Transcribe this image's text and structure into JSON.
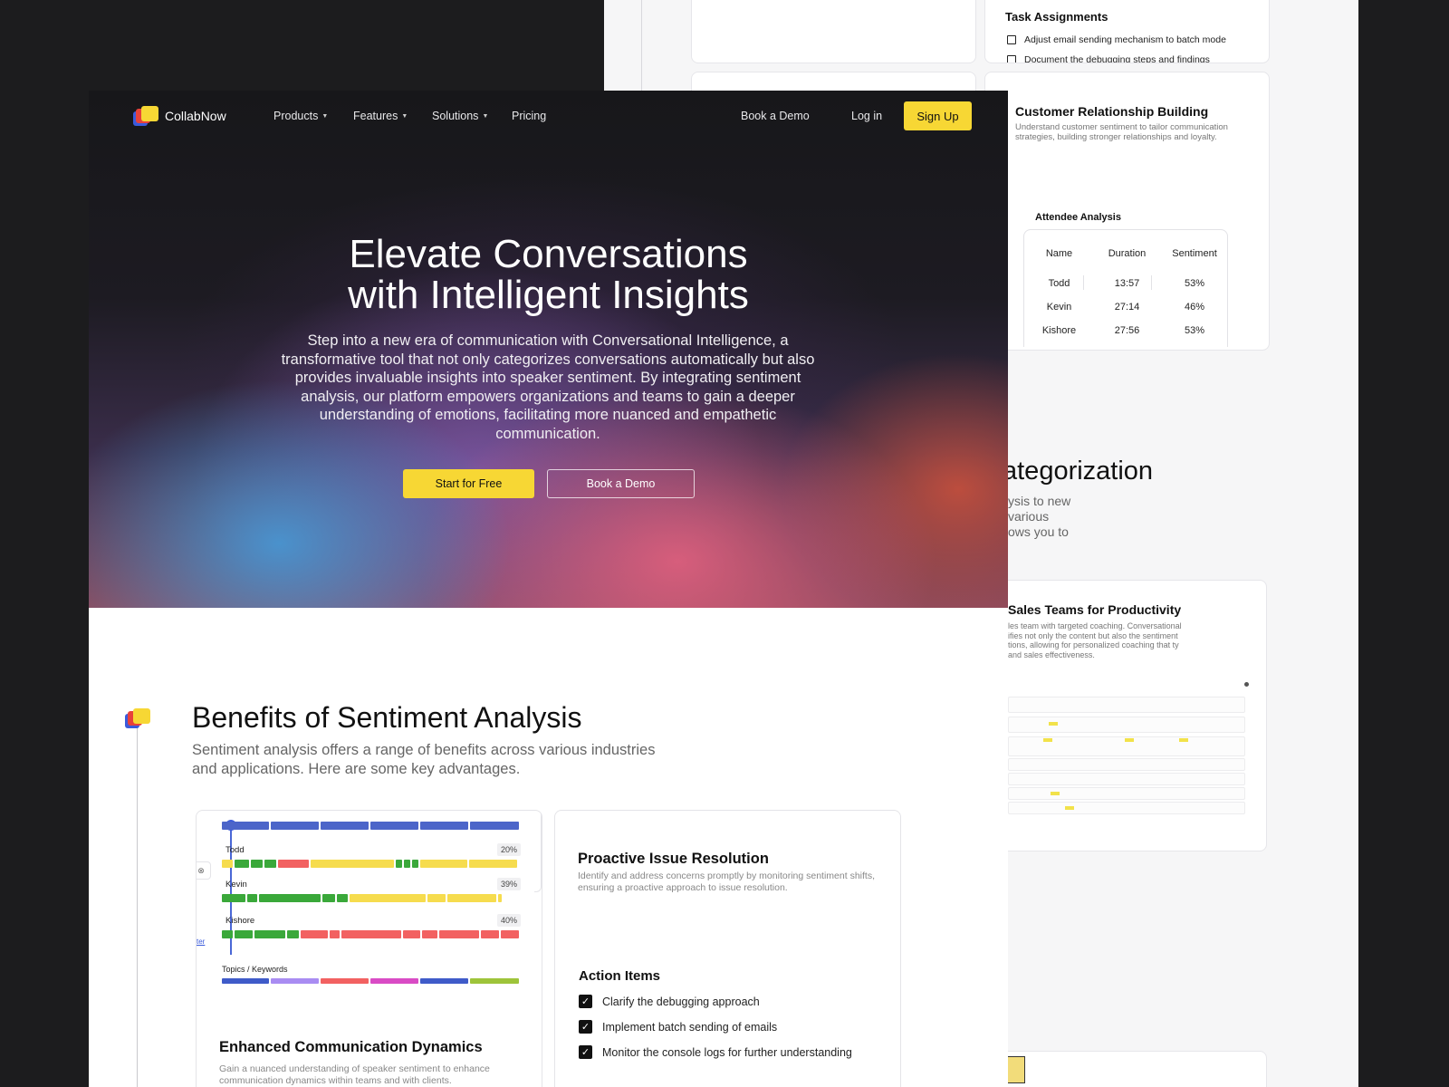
{
  "back": {
    "task_title": "Task Assignments",
    "tasks": [
      "Adjust email sending mechanism to batch mode",
      "Document the debugging steps and findings"
    ],
    "crb_title": "Customer Relationship Building",
    "crb_desc": "Understand customer sentiment to tailor communication strategies, building stronger relationships and loyalty.",
    "att_title": "Attendee Analysis",
    "att_headers": [
      "Name",
      "Duration",
      "Sentiment"
    ],
    "att_rows": [
      [
        "Todd",
        "13:57",
        "53%"
      ],
      [
        "Kevin",
        "27:14",
        "46%"
      ],
      [
        "Kishore",
        "27:56",
        "53%"
      ]
    ],
    "cat_heading": "ategorization",
    "cat_lines": [
      "ysis to new",
      "various",
      "ows you to"
    ],
    "sales_title": "Sales Teams for Productivity",
    "sales_desc": "les team with targeted coaching. Conversational ifies not only the content but also the sentiment tions, allowing for personalized coaching that ty and sales effectiveness."
  },
  "nav": {
    "brand": "CollabNow",
    "items": [
      "Products",
      "Features",
      "Solutions",
      "Pricing"
    ],
    "book_demo": "Book a Demo",
    "login": "Log in",
    "signup": "Sign Up"
  },
  "hero": {
    "title_line1": "Elevate Conversations",
    "title_line2": "with Intelligent Insights",
    "description": "Step into a new era of communication with Conversational Intelligence, a transformative tool that not only categorizes conversations automatically but also provides invaluable insights into speaker sentiment. By integrating sentiment analysis, our platform empowers organizations and teams to gain a deeper understanding of emotions, facilitating more nuanced and empathetic communication.",
    "cta_primary": "Start for Free",
    "cta_secondary": "Book a Demo"
  },
  "benefits": {
    "title": "Benefits of Sentiment Analysis",
    "description": "Sentiment analysis offers a range of benefits across various industries and applications. Here are some key advantages.",
    "speakers": [
      {
        "name": "Todd",
        "pct": "20%"
      },
      {
        "name": "Kevin",
        "pct": "39%"
      },
      {
        "name": "Kishore",
        "pct": "40%"
      }
    ],
    "topics_label": "Topics / Keywords",
    "card1_title": "Enhanced Communication Dynamics",
    "card1_desc": "Gain a nuanced understanding of speaker sentiment to enhance communication dynamics within teams and with clients.",
    "card2_title": "Proactive Issue Resolution",
    "card2_desc": "Identify and address concerns promptly by monitoring sentiment shifts, ensuring a proactive approach to issue resolution.",
    "action_title": "Action Items",
    "actions": [
      "Clarify the debugging approach",
      "Implement batch sending of emails",
      "Monitor the console logs for further understanding"
    ]
  },
  "colors": {
    "accent_yellow": "#f7d734",
    "brand_blue": "#3b5bdb",
    "brand_red": "#e8413b",
    "positive_green": "#3aa83a",
    "neutral_yellow": "#f6dc4e",
    "negative_red": "#f26161"
  }
}
